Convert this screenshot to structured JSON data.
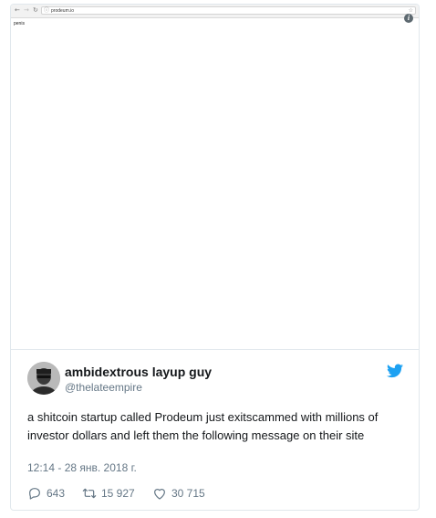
{
  "browser": {
    "url": "prodeum.io",
    "page_text": "penis",
    "nav_icons": [
      "back-arrow-icon",
      "forward-arrow-icon",
      "reload-icon"
    ],
    "info_icon": "i"
  },
  "tweet": {
    "display_name": "ambidextrous layup guy",
    "handle": "@thelateempire",
    "text": "a shitcoin startup called Prodeum just exitscammed with millions of investor dollars and left them the following message on their site",
    "timestamp": "12:14 - 28 янв. 2018 г.",
    "stats": {
      "replies": "643",
      "retweets": "15 927",
      "likes": "30 715"
    }
  },
  "colors": {
    "twitter_blue": "#1da1f2",
    "text_primary": "#14171a",
    "text_secondary": "#657786",
    "border": "#e1e8ed"
  }
}
